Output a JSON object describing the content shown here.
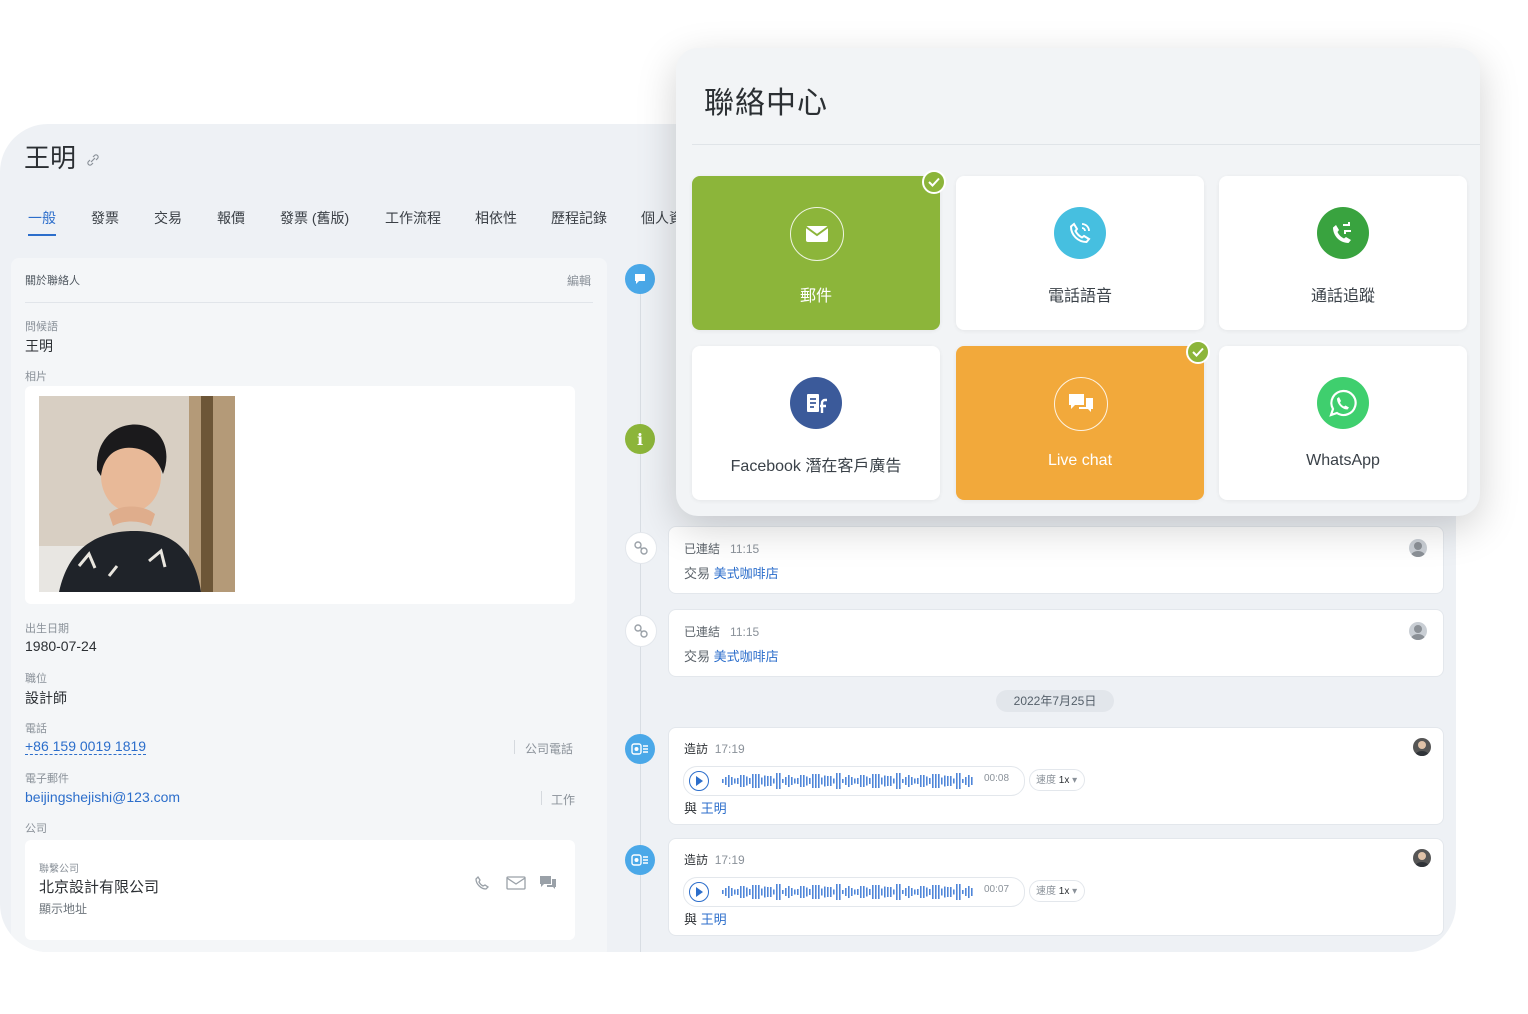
{
  "contact": {
    "name": "王明",
    "tabs": [
      "一般",
      "發票",
      "交易",
      "報價",
      "發票 (舊版)",
      "工作流程",
      "相依性",
      "歷程記錄",
      "個人資"
    ],
    "about_title": "關於聯絡人",
    "edit": "編輯",
    "fields": {
      "greeting_label": "問候語",
      "greeting_value": "王明",
      "photo_label": "相片",
      "birthday_label": "出生日期",
      "birthday_value": "1980-07-24",
      "position_label": "職位",
      "position_value": "設計師",
      "phone_label": "電話",
      "phone_value": "+86 159 0019 1819",
      "phone_type": "公司電話",
      "email_label": "電子郵件",
      "email_value": "beijingshejishi@123.com",
      "email_type": "工作",
      "company_label": "公司"
    },
    "company": {
      "caption": "聯繫公司",
      "name": "北京設計有限公司",
      "address_link": "顯示地址"
    }
  },
  "timeline": {
    "link_items": [
      {
        "label": "已連結",
        "time": "11:15",
        "type": "交易",
        "target": "美式咖啡店"
      },
      {
        "label": "已連結",
        "time": "11:15",
        "type": "交易",
        "target": "美式咖啡店"
      }
    ],
    "date_separator": "2022年7月25日",
    "visits": [
      {
        "label": "造訪",
        "time": "17:19",
        "duration": "00:08",
        "speed_label": "速度",
        "speed": "1x",
        "with": "與",
        "person": "王明"
      },
      {
        "label": "造訪",
        "time": "17:19",
        "duration": "00:07",
        "speed_label": "速度",
        "speed": "1x",
        "with": "與",
        "person": "王明"
      }
    ]
  },
  "contact_center": {
    "title": "聯絡中心",
    "tiles": [
      {
        "label": "郵件",
        "icon": "mail-icon",
        "bg": "#8cb53a",
        "checked": true
      },
      {
        "label": "電話語音",
        "icon": "phone-icon",
        "bg": "#ffffff",
        "checked": false
      },
      {
        "label": "通話追蹤",
        "icon": "call-tracking-icon",
        "bg": "#ffffff",
        "checked": false
      },
      {
        "label": "Facebook 潛在客戶廣告",
        "icon": "facebook-leads-icon",
        "bg": "#ffffff",
        "checked": false
      },
      {
        "label": "Live chat",
        "icon": "chat-icon",
        "bg": "#f2a93b",
        "checked": true
      },
      {
        "label": "WhatsApp",
        "icon": "whatsapp-icon",
        "bg": "#ffffff",
        "checked": false
      }
    ]
  },
  "colors": {
    "accent": "#2c6ecb",
    "mail_green": "#8cb53a",
    "chat_orange": "#f2a93b",
    "whatsapp": "#3fcf6e",
    "phone_teal": "#46bfe0",
    "tracking_green": "#39a33f",
    "facebook_blue": "#3b5a9a"
  }
}
